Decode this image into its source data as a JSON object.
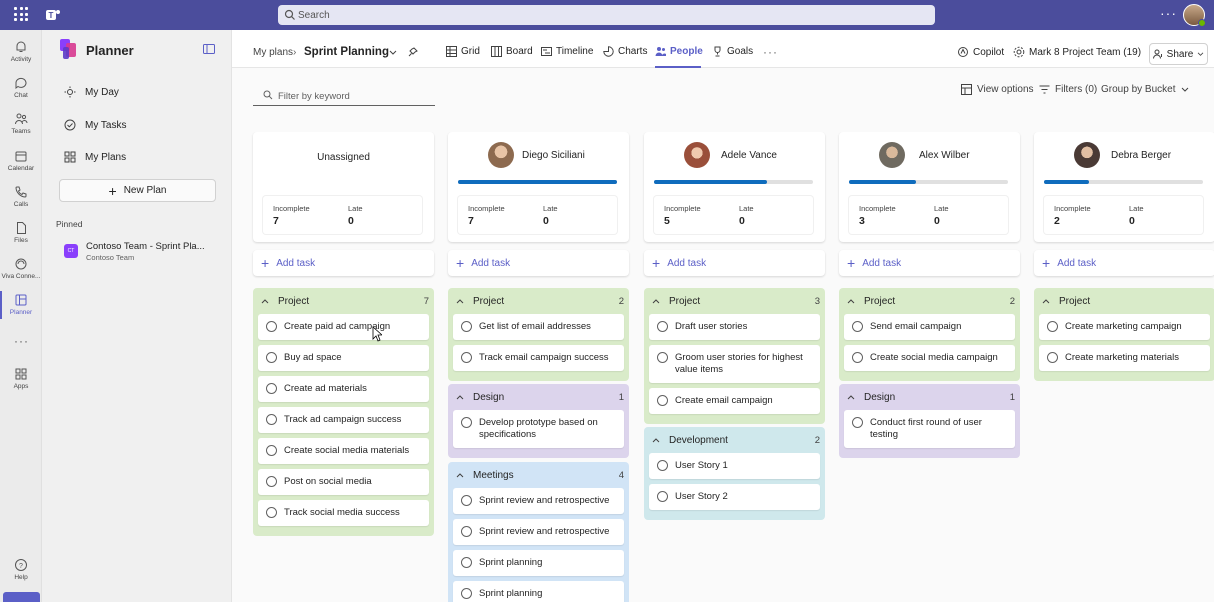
{
  "topbar": {
    "search_placeholder": "Search",
    "more_label": "···"
  },
  "rail": {
    "items": [
      {
        "label": "Activity",
        "icon": "bell-icon"
      },
      {
        "label": "Chat",
        "icon": "chat-icon"
      },
      {
        "label": "Teams",
        "icon": "teams-icon"
      },
      {
        "label": "Calendar",
        "icon": "calendar-icon"
      },
      {
        "label": "Calls",
        "icon": "phone-icon"
      },
      {
        "label": "Files",
        "icon": "file-icon"
      },
      {
        "label": "Viva Conne...",
        "icon": "viva-icon"
      },
      {
        "label": "Planner",
        "icon": "planner-icon"
      }
    ],
    "more_label": "···",
    "apps_label": "Apps",
    "help_label": "Help"
  },
  "sidebar": {
    "title": "Planner",
    "nav": [
      {
        "label": "My Day",
        "icon": "sun-icon"
      },
      {
        "label": "My Tasks",
        "icon": "tasks-icon"
      },
      {
        "label": "My Plans",
        "icon": "grid-icon"
      }
    ],
    "new_plan_label": "New Plan",
    "pinned_label": "Pinned",
    "pinned_item": {
      "badge": "CT",
      "name": "Contoso Team - Sprint Pla...",
      "sub": "Contoso Team"
    }
  },
  "header": {
    "breadcrumb_root": "My plans",
    "plan_name": "Sprint Planning",
    "tabs": [
      {
        "label": "Grid",
        "icon": "grid-icon"
      },
      {
        "label": "Board",
        "icon": "board-icon"
      },
      {
        "label": "Timeline",
        "icon": "timeline-icon"
      },
      {
        "label": "Charts",
        "icon": "chart-icon"
      },
      {
        "label": "People",
        "icon": "people-icon",
        "active": true
      },
      {
        "label": "Goals",
        "icon": "trophy-icon"
      }
    ],
    "more_label": "···",
    "copilot_label": "Copilot",
    "team_label": "Mark 8 Project Team (19)",
    "share_label": "Share"
  },
  "toolbar": {
    "filter_placeholder": "Filter by keyword",
    "view_options_label": "View options",
    "filters_label": "Filters (0)",
    "group_by_label": "Group by Bucket"
  },
  "labels": {
    "incomplete": "Incomplete",
    "late": "Late",
    "add_task": "Add task"
  },
  "columns": [
    {
      "name": "Unassigned",
      "incomplete": "7",
      "late": "0",
      "progress": null,
      "buckets": [
        {
          "name": "Project",
          "count": "7",
          "type": "project",
          "tasks": [
            "Create paid ad campaign",
            "Buy ad space",
            "Create ad materials",
            "Track ad campaign success",
            "Create social media materials",
            "Post on social media",
            "Track social media success"
          ]
        }
      ]
    },
    {
      "name": "Diego Siciliani",
      "incomplete": "7",
      "late": "0",
      "progress": 1.0,
      "avatar": "#8d6a4f",
      "buckets": [
        {
          "name": "Project",
          "count": "2",
          "type": "project",
          "tasks": [
            "Get list of email addresses",
            "Track email campaign success"
          ]
        },
        {
          "name": "Design",
          "count": "1",
          "type": "design",
          "tasks": [
            "Develop prototype based on specifications"
          ]
        },
        {
          "name": "Meetings",
          "count": "4",
          "type": "meetings",
          "tasks": [
            "Sprint review and retrospective",
            "Sprint review and retrospective",
            "Sprint planning",
            "Sprint planning"
          ]
        }
      ]
    },
    {
      "name": "Adele Vance",
      "incomplete": "5",
      "late": "0",
      "progress": 0.71,
      "avatar": "#9a4f3a",
      "buckets": [
        {
          "name": "Project",
          "count": "3",
          "type": "project",
          "tasks": [
            "Draft user stories",
            "Groom user stories for highest value items",
            "Create email campaign"
          ]
        },
        {
          "name": "Development",
          "count": "2",
          "type": "development",
          "tasks": [
            "User Story 1",
            "User Story 2"
          ]
        }
      ]
    },
    {
      "name": "Alex Wilber",
      "incomplete": "3",
      "late": "0",
      "progress": 0.42,
      "avatar": "#6f6a60",
      "buckets": [
        {
          "name": "Project",
          "count": "2",
          "type": "project",
          "tasks": [
            "Send email campaign",
            "Create social media campaign"
          ]
        },
        {
          "name": "Design",
          "count": "1",
          "type": "design",
          "tasks": [
            "Conduct first round of user testing"
          ]
        }
      ]
    },
    {
      "name": "Debra Berger",
      "incomplete": "2",
      "late": "0",
      "progress": 0.28,
      "avatar": "#4a3a35",
      "buckets": [
        {
          "name": "Project",
          "count": "",
          "type": "project",
          "tasks": [
            "Create marketing campaign",
            "Create marketing materials"
          ]
        }
      ]
    }
  ],
  "colors": {
    "accent": "#5b5fc7",
    "topbar": "#4b4d9c",
    "progress": "#0f6cbd",
    "project": "#d9ebc9",
    "design": "#dcd4ec",
    "meetings": "#d1e4f6",
    "development": "#cfe8ec"
  }
}
